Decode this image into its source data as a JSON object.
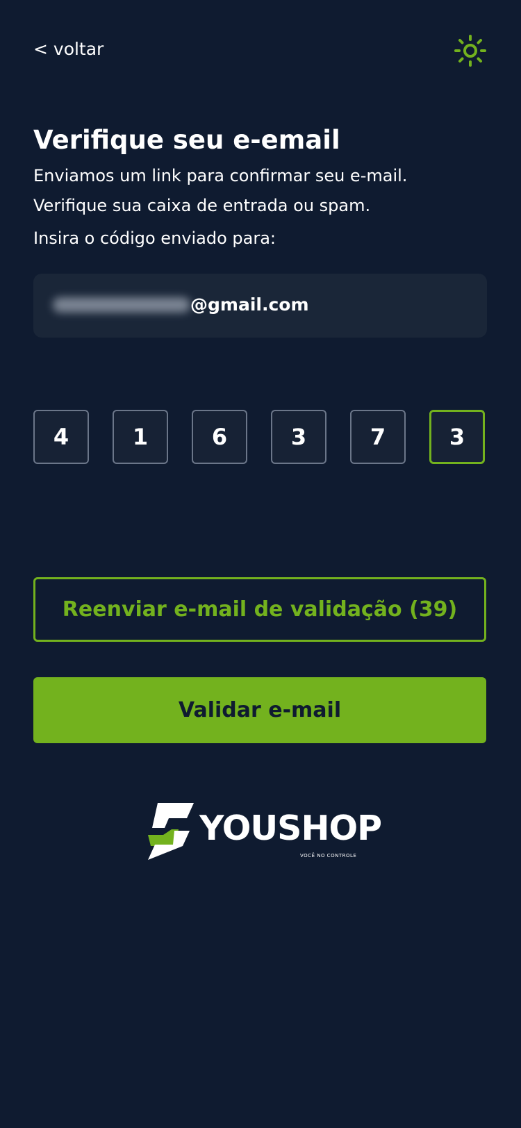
{
  "header": {
    "back_label": "< voltar",
    "theme_icon": "sun-icon"
  },
  "main": {
    "title": "Verifique seu e-email",
    "description_line1": "Enviamos um link para confirmar seu e-mail.",
    "description_line2": "Verifique sua caixa de entrada ou spam.",
    "code_prompt": "Insira o código enviado para:",
    "email_domain": "@gmail.com",
    "code_digits": [
      "4",
      "1",
      "6",
      "3",
      "7",
      "3"
    ],
    "resend_label": "Reenviar e-mail de validação (39)",
    "validate_label": "Validar e-mail"
  },
  "brand": {
    "name": "YOUSHOP",
    "tagline": "VOCÊ NO CONTROLE",
    "logo_icon": "youshop-s-logo-icon"
  },
  "colors": {
    "background": "#0f1b30",
    "accent": "#73b21e",
    "field_background": "#1a2638",
    "digit_border": "#6b7689"
  }
}
